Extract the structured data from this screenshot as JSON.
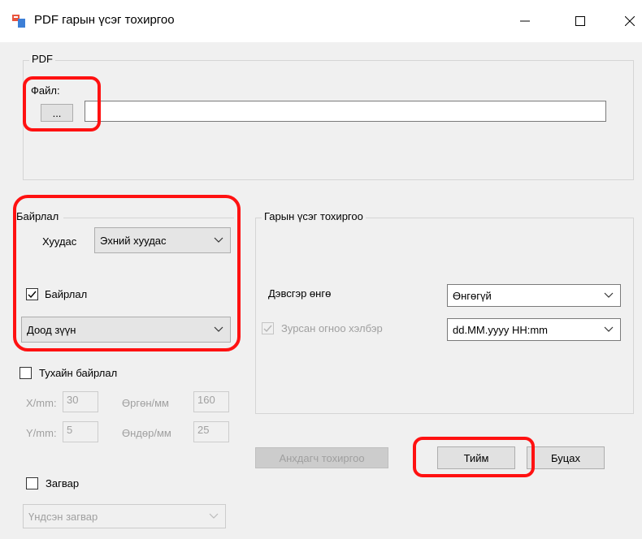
{
  "window": {
    "title": "PDF гарын үсэг тохиргоо",
    "icon": "app-form-icon"
  },
  "pdf_group": {
    "legend": "PDF",
    "file_label": "Файл:",
    "browse_label": "...",
    "file_path_value": ""
  },
  "layout_group": {
    "legend": "Байрлал",
    "page_label": "Хуудас",
    "page_value": "Эхний хуудас",
    "position_checkbox_label": "Байрлал",
    "position_checked": true,
    "position_value": "Доод зүүн"
  },
  "custom_position": {
    "checkbox_label": "Тухайн байрлал",
    "checked": false,
    "x_label": "X/mm:",
    "x_value": "30",
    "width_label": "Өргөн/мм",
    "width_value": "160",
    "y_label": "Y/mm:",
    "y_value": "5",
    "height_label": "Өндөр/мм",
    "height_value": "25"
  },
  "template": {
    "checkbox_label": "Загвар",
    "checked": false,
    "select_value": "Үндсэн загвар"
  },
  "signature_group": {
    "legend": "Гарын үсэг тохиргоо",
    "background_label": "Дэвсгэр өнгө",
    "background_value": "Өнгөгүй",
    "date_format_label": "Зурсан огноо хэлбэр",
    "date_format_checked": true,
    "date_format_value": "dd.MM.yyyy HH:mm"
  },
  "buttons": {
    "defaults": "Анхдагч тохиргоо",
    "ok": "Тийм",
    "cancel": "Буцах"
  },
  "colors": {
    "highlight": "#ff1111",
    "client_bg": "#f0f0f0"
  }
}
